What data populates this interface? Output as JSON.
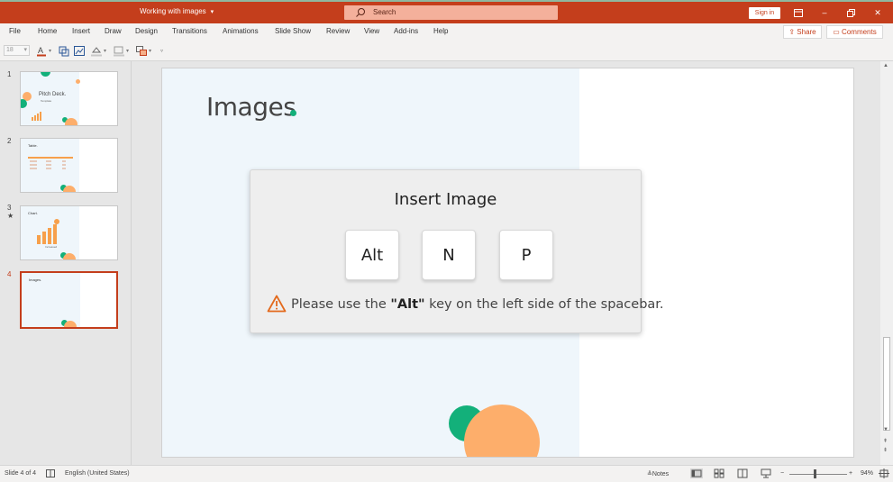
{
  "titlebar": {
    "doc_title": "Working with images",
    "search_placeholder": "Search",
    "signin_label": "Sign in",
    "colors": {
      "bar": "#c43e1c"
    }
  },
  "menu": {
    "items": [
      "File",
      "Home",
      "Insert",
      "Draw",
      "Design",
      "Transitions",
      "Animations",
      "Slide Show",
      "Review",
      "View",
      "Add-ins",
      "Help"
    ],
    "share_label": "Share",
    "comments_label": "Comments"
  },
  "toolbar": {
    "font_size_value": "18"
  },
  "thumbnails": [
    {
      "number": "1",
      "title": "Pitch Deck.",
      "subtitle": "Template"
    },
    {
      "number": "2",
      "title": "Table."
    },
    {
      "number": "3",
      "title": "Chart.",
      "star": "★",
      "caption": "Increased"
    },
    {
      "number": "4",
      "title": "Images.",
      "selected": true
    }
  ],
  "slide": {
    "title": "Images",
    "accent_green": "#13b07a",
    "accent_orange": "#fdae6b"
  },
  "dialog": {
    "title": "Insert Image",
    "keys": [
      "Alt",
      "N",
      "P"
    ],
    "warning_before": "Please use the ",
    "warning_key": "\"Alt\"",
    "warning_after": " key on the left side of the spacebar."
  },
  "statusbar": {
    "slide_info": "Slide 4 of 4",
    "language": "English (United States)",
    "notes_label": "Notes",
    "zoom_minus": "−",
    "zoom_plus": "+",
    "zoom_level": "94%"
  }
}
